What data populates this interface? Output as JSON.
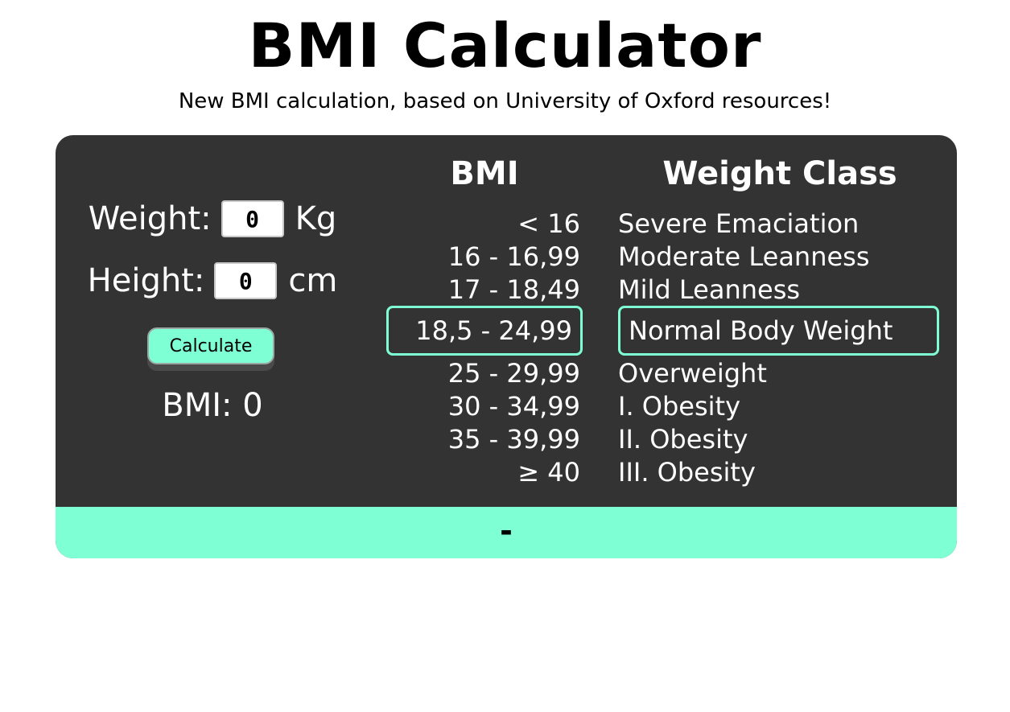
{
  "header": {
    "title": "BMI Calculator",
    "subtitle": "New BMI calculation, based on University of Oxford resources!"
  },
  "form": {
    "weight_label": "Weight:",
    "weight_value": "0",
    "weight_unit": "Kg",
    "height_label": "Height:",
    "height_value": "0",
    "height_unit": "cm",
    "calculate_label": "Calculate",
    "result_label": "BMI: 0"
  },
  "table": {
    "bmi_header": "BMI",
    "class_header": "Weight Class",
    "rows": [
      {
        "bmi": "< 16",
        "class": "Severe Emaciation"
      },
      {
        "bmi": "16 - 16,99",
        "class": "Moderate Leanness"
      },
      {
        "bmi": "17 - 18,49",
        "class": "Mild Leanness"
      },
      {
        "bmi": "18,5 - 24,99",
        "class": "Normal Body Weight"
      },
      {
        "bmi": "25 - 29,99",
        "class": "Overweight"
      },
      {
        "bmi": "30 - 34,99",
        "class": "I. Obesity"
      },
      {
        "bmi": "35 - 39,99",
        "class": "II. Obesity"
      },
      {
        "bmi": "≥ 40",
        "class": "III. Obesity"
      }
    ],
    "highlighted_row": 3
  },
  "footer": {
    "status": "-"
  },
  "colors": {
    "panel": "#333333",
    "accent": "#7fffd4",
    "text_light": "#ffffff"
  }
}
